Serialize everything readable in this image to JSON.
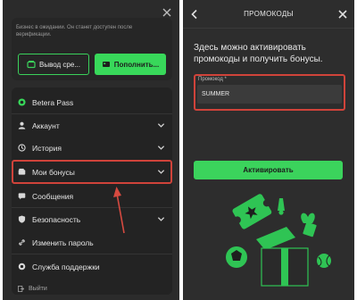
{
  "left": {
    "wallet": {
      "pending_text": "Бизнес в ожидании. Он станет доступен после верификации.",
      "withdraw_label": "Вывод сре...",
      "deposit_label": "Пополнить..."
    },
    "menu": {
      "betera_pass": "Betera Pass",
      "account": "Аккаунт",
      "history": "История",
      "bonuses": "Мои бонусы",
      "messages": "Сообщения",
      "security": "Безопасность",
      "change_password": "Изменить пароль",
      "support": "Служба поддержки"
    },
    "logout": "Выйти"
  },
  "right": {
    "title": "ПРОМОКОДЫ",
    "intro": "Здесь можно активировать промокоды и получить бонусы.",
    "promo_label": "Промокод *",
    "promo_value": "SUMMER",
    "activate_label": "Активировать"
  },
  "colors": {
    "accent_green": "#38d85a",
    "highlight_red": "#d0433a",
    "panel_bg": "#2b2b2b"
  }
}
